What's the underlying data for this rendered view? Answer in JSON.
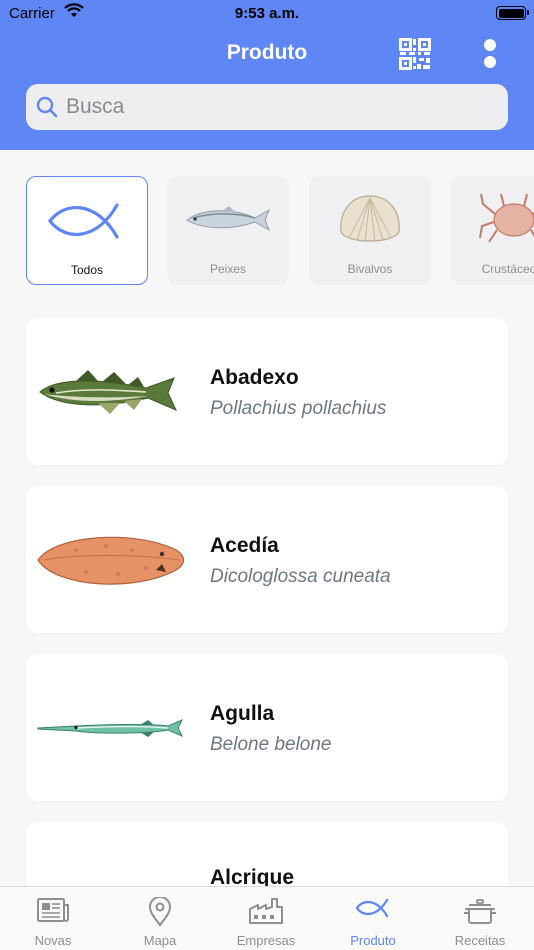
{
  "status_bar": {
    "carrier": "Carrier",
    "time": "9:53 a.m."
  },
  "header": {
    "title": "Produto",
    "qr_icon": "qr-code-icon",
    "more_icon": "more-vertical-icon"
  },
  "search": {
    "placeholder": "Busca",
    "value": ""
  },
  "categories": [
    {
      "label": "Todos",
      "icon": "fish-outline-icon",
      "selected": true
    },
    {
      "label": "Peixes",
      "icon": "fish-image"
    },
    {
      "label": "Bivalvos",
      "icon": "clam-shell-image"
    },
    {
      "label": "Crustáceos",
      "icon": "crab-image"
    }
  ],
  "products": [
    {
      "name": "Abadexo",
      "scientific": "Pollachius pollachius"
    },
    {
      "name": "Acedía",
      "scientific": "Dicologlossa cuneata"
    },
    {
      "name": "Agulla",
      "scientific": "Belone belone"
    },
    {
      "name": "Alcrique",
      "scientific": ""
    }
  ],
  "tabs": [
    {
      "label": "Novas",
      "icon": "newspaper-icon"
    },
    {
      "label": "Mapa",
      "icon": "map-pin-icon"
    },
    {
      "label": "Empresas",
      "icon": "factory-icon"
    },
    {
      "label": "Produto",
      "icon": "fish-icon",
      "active": true
    },
    {
      "label": "Receitas",
      "icon": "cooking-pot-icon"
    }
  ],
  "colors": {
    "accent": "#5f86f5",
    "background": "#f7f7f7"
  }
}
